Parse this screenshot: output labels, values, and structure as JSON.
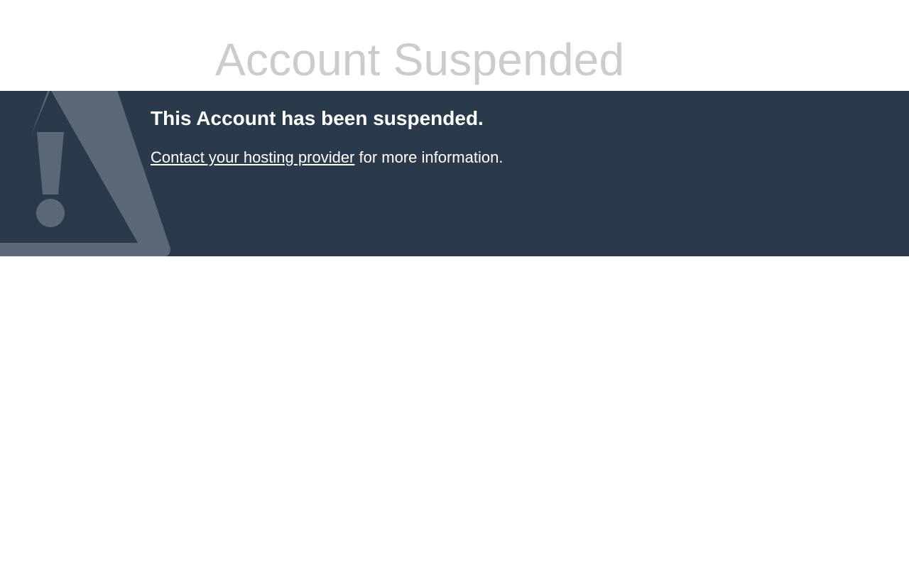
{
  "page": {
    "title": "Account Suspended"
  },
  "banner": {
    "heading": "This Account has been suspended.",
    "contact_link": "Contact your hosting provider",
    "message_suffix": " for more information.",
    "background_color": "#2a3a4b",
    "icon": "warning-triangle-icon"
  }
}
